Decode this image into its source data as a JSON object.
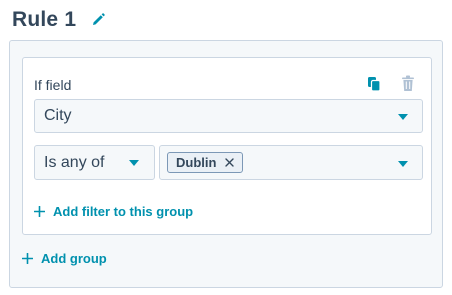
{
  "rule": {
    "title": "Rule 1"
  },
  "group": {
    "if_label": "If field",
    "field_select": {
      "value": "City"
    },
    "operator_select": {
      "value": "Is any of"
    },
    "values": [
      {
        "label": "Dublin"
      }
    ],
    "add_filter_label": "Add filter to this group"
  },
  "add_group_label": "Add group",
  "icons": {
    "edit": "pencil-icon",
    "copy": "copy-icon",
    "delete": "trash-icon",
    "dropdown": "caret-down-icon",
    "remove_tag": "close-icon",
    "add": "plus-icon"
  },
  "colors": {
    "text": "#33475b",
    "accent": "#0091ae",
    "border": "#cbd6e2",
    "panel_bg": "#f5f8fa",
    "tag_bg": "#eaf0f6",
    "disabled_icon": "#b0c1d4"
  }
}
